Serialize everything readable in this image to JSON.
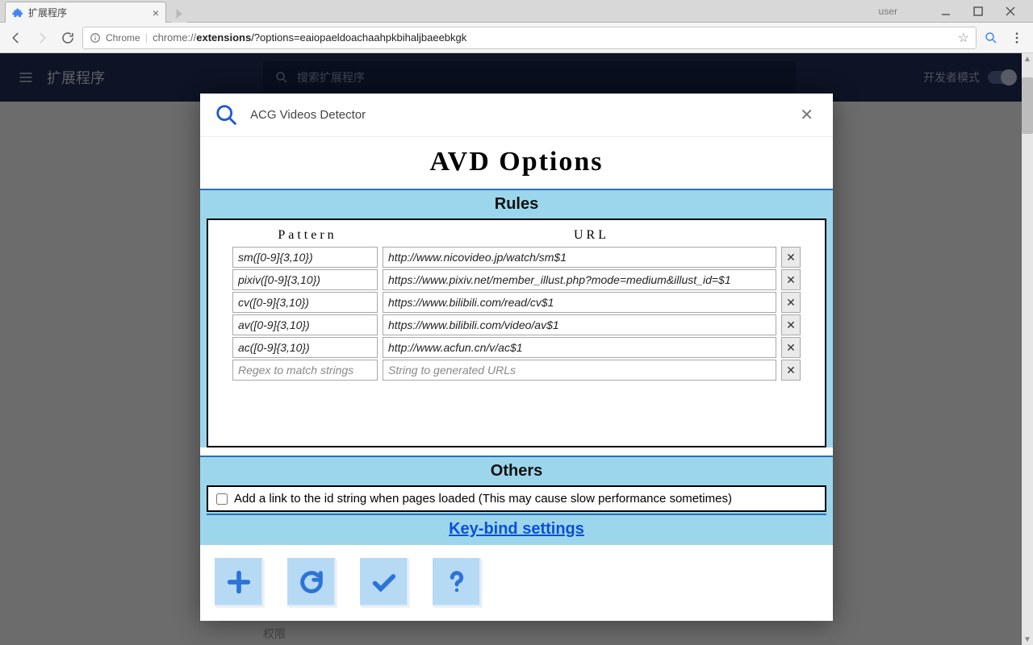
{
  "window": {
    "user": "user",
    "tab_title": "扩展程序"
  },
  "toolbar": {
    "secure_label": "Chrome",
    "url_prefix": "chrome://",
    "url_bold": "extensions",
    "url_rest": "/?options=eaiopaeldoachaahpkbihaljbaeebkgk"
  },
  "extensions_page": {
    "title": "扩展程序",
    "search_placeholder": "搜索扩展程序",
    "dev_mode": "开发者模式",
    "permissions_label": "权限"
  },
  "modal": {
    "app_name": "ACG Videos Detector",
    "options_title": "AVD Options",
    "rules_title": "Rules",
    "col_pattern": "Pattern",
    "col_url": "URL",
    "rules": [
      {
        "pattern": "sm([0-9]{3,10})",
        "url": "http://www.nicovideo.jp/watch/sm$1"
      },
      {
        "pattern": "pixiv([0-9]{3,10})",
        "url": "https://www.pixiv.net/member_illust.php?mode=medium&illust_id=$1"
      },
      {
        "pattern": "cv([0-9]{3,10})",
        "url": "https://www.bilibili.com/read/cv$1"
      },
      {
        "pattern": "av([0-9]{3,10})",
        "url": "https://www.bilibili.com/video/av$1"
      },
      {
        "pattern": "ac([0-9]{3,10})",
        "url": "http://www.acfun.cn/v/ac$1"
      }
    ],
    "placeholder_pattern": "Regex to match strings",
    "placeholder_url": "String to generated URLs",
    "others_title": "Others",
    "others_checkbox_label": "Add a link to the id string when pages loaded (This may cause slow performance sometimes)",
    "keybind_link": "Key-bind settings"
  }
}
